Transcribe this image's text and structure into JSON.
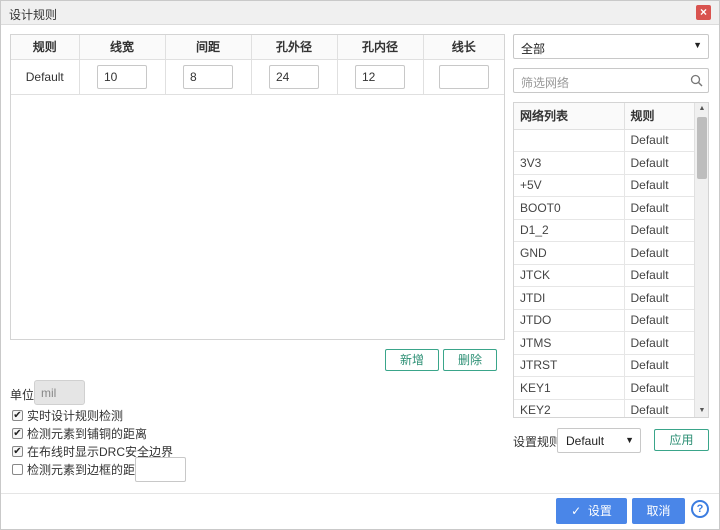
{
  "dialog": {
    "title": "设计规则",
    "close_glyph": "×"
  },
  "rules_table": {
    "headers": [
      "规则",
      "线宽",
      "间距",
      "孔外径",
      "孔内径",
      "线长"
    ],
    "rows": [
      {
        "rule": "Default",
        "width": "10",
        "spacing": "8",
        "via_outer": "24",
        "via_inner": "12",
        "length": ""
      }
    ]
  },
  "rule_actions": {
    "add_label": "新增",
    "delete_label": "删除"
  },
  "unit": {
    "label": "单位",
    "value": "mil"
  },
  "options": [
    {
      "label": "实时设计规则检测",
      "checked": true
    },
    {
      "label": "检测元素到铺铜的距离",
      "checked": true
    },
    {
      "label": "在布线时显示DRC安全边界",
      "checked": true
    },
    {
      "label": "检测元素到边框的距离",
      "checked": false
    }
  ],
  "net_panel": {
    "filter_select": "全部",
    "search_placeholder": "筛选网络",
    "headers": [
      "网络列表",
      "规则"
    ],
    "rows": [
      {
        "net": "",
        "rule": "Default"
      },
      {
        "net": "3V3",
        "rule": "Default"
      },
      {
        "net": "+5V",
        "rule": "Default"
      },
      {
        "net": "BOOT0",
        "rule": "Default"
      },
      {
        "net": "D1_2",
        "rule": "Default"
      },
      {
        "net": "GND",
        "rule": "Default"
      },
      {
        "net": "JTCK",
        "rule": "Default"
      },
      {
        "net": "JTDI",
        "rule": "Default"
      },
      {
        "net": "JTDO",
        "rule": "Default"
      },
      {
        "net": "JTMS",
        "rule": "Default"
      },
      {
        "net": "JTRST",
        "rule": "Default"
      },
      {
        "net": "KEY1",
        "rule": "Default"
      },
      {
        "net": "KEY2",
        "rule": "Default"
      }
    ],
    "set_rule_label": "设置规则",
    "set_rule_value": "Default",
    "apply_label": "应用"
  },
  "footer": {
    "confirm_label": "设置",
    "cancel_label": "取消",
    "help_glyph": "?"
  },
  "colors": {
    "primary": "#4a86e8",
    "accent_green": "#3aa58a",
    "close_red": "#d9534f"
  }
}
